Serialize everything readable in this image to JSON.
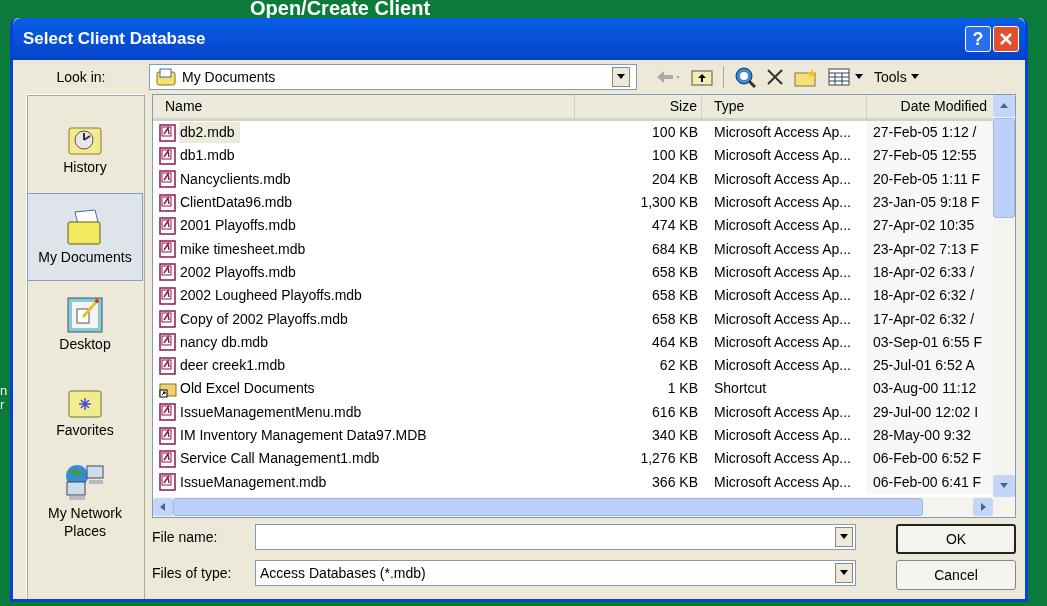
{
  "background": {
    "heading": "Open/Create Client",
    "fragments": [
      "n",
      "r"
    ]
  },
  "window": {
    "title": "Select Client Database",
    "help_label": "?"
  },
  "look_in": {
    "label": "Look in:",
    "value": "My Documents"
  },
  "toolbar": {
    "tools_label": "Tools"
  },
  "places": [
    {
      "label": "History",
      "kind": "history",
      "selected": false
    },
    {
      "label": "My Documents",
      "kind": "documents",
      "selected": true
    },
    {
      "label": "Desktop",
      "kind": "desktop",
      "selected": false
    },
    {
      "label": "Favorites",
      "kind": "favorites",
      "selected": false
    },
    {
      "label": "My Network Places",
      "kind": "network",
      "selected": false
    }
  ],
  "table": {
    "columns": [
      "Name",
      "Size",
      "Type",
      "Date Modified"
    ],
    "rows": [
      {
        "kind": "database",
        "name": "db2.mdb",
        "size": "100 KB",
        "type": "Microsoft Access Ap...",
        "date": "27-Feb-05 1:12 /",
        "selected": true
      },
      {
        "kind": "database",
        "name": "db1.mdb",
        "size": "100 KB",
        "type": "Microsoft Access Ap...",
        "date": "27-Feb-05 12:55",
        "selected": false
      },
      {
        "kind": "database",
        "name": "Nancyclients.mdb",
        "size": "204 KB",
        "type": "Microsoft Access Ap...",
        "date": "20-Feb-05 1:11 F",
        "selected": false
      },
      {
        "kind": "database",
        "name": "ClientData96.mdb",
        "size": "1,300 KB",
        "type": "Microsoft Access Ap...",
        "date": "23-Jan-05 9:18 F",
        "selected": false
      },
      {
        "kind": "database",
        "name": "2001 Playoffs.mdb",
        "size": "474 KB",
        "type": "Microsoft Access Ap...",
        "date": "27-Apr-02 10:35",
        "selected": false
      },
      {
        "kind": "database",
        "name": "mike timesheet.mdb",
        "size": "684 KB",
        "type": "Microsoft Access Ap...",
        "date": "23-Apr-02 7:13 F",
        "selected": false
      },
      {
        "kind": "database",
        "name": "2002 Playoffs.mdb",
        "size": "658 KB",
        "type": "Microsoft Access Ap...",
        "date": "18-Apr-02 6:33 /",
        "selected": false
      },
      {
        "kind": "database",
        "name": "2002 Lougheed Playoffs.mdb",
        "size": "658 KB",
        "type": "Microsoft Access Ap...",
        "date": "18-Apr-02 6:32 /",
        "selected": false
      },
      {
        "kind": "database",
        "name": "Copy of 2002 Playoffs.mdb",
        "size": "658 KB",
        "type": "Microsoft Access Ap...",
        "date": "17-Apr-02 6:32 /",
        "selected": false
      },
      {
        "kind": "database",
        "name": "nancy db.mdb",
        "size": "464 KB",
        "type": "Microsoft Access Ap...",
        "date": "03-Sep-01 6:55 F",
        "selected": false
      },
      {
        "kind": "database",
        "name": "deer creek1.mdb",
        "size": "62 KB",
        "type": "Microsoft Access Ap...",
        "date": "25-Jul-01 6:52 A",
        "selected": false
      },
      {
        "kind": "shortcut",
        "name": "Old Excel Documents",
        "size": "1 KB",
        "type": "Shortcut",
        "date": "03-Aug-00 11:12",
        "selected": false
      },
      {
        "kind": "database",
        "name": "IssueManagementMenu.mdb",
        "size": "616 KB",
        "type": "Microsoft Access Ap...",
        "date": "29-Jul-00 12:02 I",
        "selected": false
      },
      {
        "kind": "database",
        "name": "IM Inventory Management Data97.MDB",
        "size": "340 KB",
        "type": "Microsoft Access Ap...",
        "date": "28-May-00 9:32",
        "selected": false
      },
      {
        "kind": "database",
        "name": "Service Call Management1.mdb",
        "size": "1,276 KB",
        "type": "Microsoft Access Ap...",
        "date": "06-Feb-00 6:52 F",
        "selected": false
      },
      {
        "kind": "database",
        "name": "IssueManagement.mdb",
        "size": "366 KB",
        "type": "Microsoft Access Ap...",
        "date": "06-Feb-00 6:41 F",
        "selected": false
      }
    ]
  },
  "file_name": {
    "label": "File name:"
  },
  "file_type": {
    "label": "Files of type:",
    "value": "Access Databases (*.mdb)"
  },
  "buttons": [
    "OK",
    "Cancel"
  ]
}
